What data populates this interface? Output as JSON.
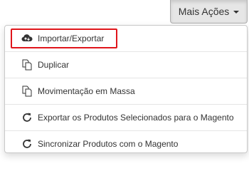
{
  "toolbar": {
    "more_actions_label": "Mais Ações",
    "caret_icon": "caret-down-icon"
  },
  "menu": {
    "items": [
      {
        "label": "Importar/Exportar",
        "icon": "cloud-upload-download-icon",
        "highlighted": true
      },
      {
        "label": "Duplicar",
        "icon": "copy-icon"
      },
      {
        "label": "Movimentação em Massa",
        "icon": "copy-icon"
      },
      {
        "label": "Exportar os Produtos Selecionados para o Magento",
        "icon": "refresh-icon"
      },
      {
        "label": "Sincronizar Produtos com o Magento",
        "icon": "refresh-icon"
      }
    ]
  },
  "colors": {
    "highlight_border": "#e0151b",
    "text": "#333333",
    "button_bg": "#e6e6e6"
  }
}
